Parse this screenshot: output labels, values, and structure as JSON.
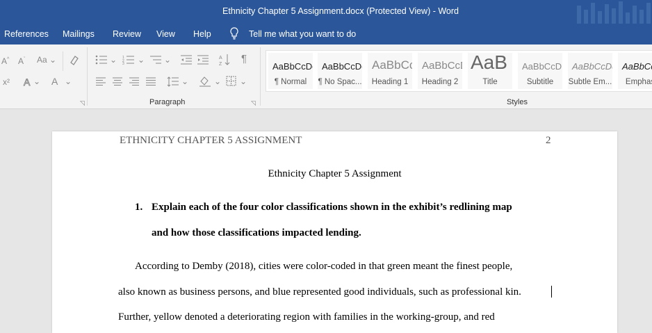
{
  "window": {
    "title": "Ethnicity Chapter 5 Assignment.docx (Protected View)  -  Word"
  },
  "menu": [
    "References",
    "Mailings",
    "Review",
    "View",
    "Help"
  ],
  "tell_me": "Tell me what you want to do",
  "ribbon": {
    "groups": {
      "paragraph": "Paragraph",
      "styles": "Styles"
    },
    "font_controls": {
      "grow": "A",
      "shrink": "A",
      "case": "Aa",
      "superscript": "x²",
      "effects": "A",
      "color": "A"
    },
    "sort_icon": "sort-az-icon",
    "pilcrow": "¶",
    "styles": [
      {
        "sample": "AaBbCcDc",
        "name": "¶ Normal"
      },
      {
        "sample": "AaBbCcDc",
        "name": "¶ No Spac..."
      },
      {
        "sample": "AaBbCc",
        "name": "Heading 1"
      },
      {
        "sample": "AaBbCcD",
        "name": "Heading 2"
      },
      {
        "sample": "AaB",
        "name": "Title"
      },
      {
        "sample": "AaBbCcD",
        "name": "Subtitle"
      },
      {
        "sample": "AaBbCcDd",
        "name": "Subtle Em..."
      },
      {
        "sample": "AaBbCc",
        "name": "Emphas"
      }
    ]
  },
  "document": {
    "header": "ETHNICITY CHAPTER 5 ASSIGNMENT",
    "page_number": "2",
    "title": "Ethnicity Chapter 5 Assignment",
    "question_number": "1.",
    "question_lines": [
      "Explain each of the four color classifications shown in the exhibit’s redlining map",
      "and how those classifications impacted lending."
    ],
    "body_lines": [
      "According to Demby (2018), cities were color-coded in that green meant the finest people,",
      "also known as business persons, and blue represented good individuals, such as professional kin.",
      "Further, yellow denoted a deteriorating region with families in the working-group, and red"
    ]
  },
  "colors": {
    "titlebar": "#2b579a",
    "ribbon": "#f3f3f3",
    "canvas": "#e6e6e6"
  }
}
